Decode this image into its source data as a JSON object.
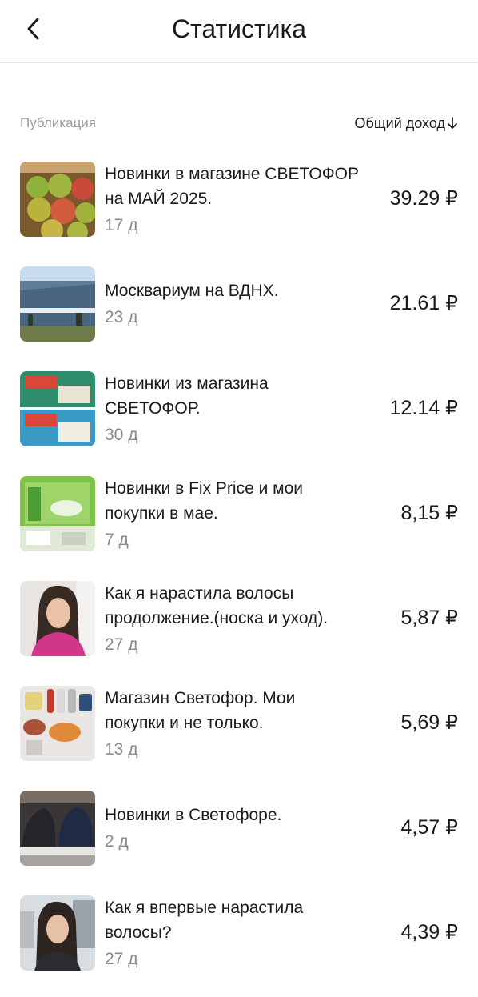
{
  "header": {
    "title": "Статистика",
    "back_icon": "chevron-left-icon"
  },
  "columns": {
    "left": "Публикация",
    "right": "Общий доход",
    "sort_icon": "arrow-down-icon"
  },
  "items": [
    {
      "title_line1": "Новинки в магазине СВЕТОФОР",
      "title_line2": "на МАЙ 2025.",
      "age": "17 д",
      "income": "39.29 ₽"
    },
    {
      "title_line1": "Москвариум на ВДНХ.",
      "title_line2": "",
      "age": "23 д",
      "income": "21.61 ₽"
    },
    {
      "title_line1": "Новинки из магазина",
      "title_line2": "СВЕТОФОР.",
      "age": "30 д",
      "income": "12.14 ₽"
    },
    {
      "title_line1": "Новинки в Fix Price и мои",
      "title_line2": "покупки в мае.",
      "age": "7 д",
      "income": "8,15 ₽"
    },
    {
      "title_line1": "Как я нарастила волосы",
      "title_line2": "продолжение.(носка и уход).",
      "age": "27 д",
      "income": "5,87 ₽"
    },
    {
      "title_line1": "Магазин Светофор. Мои",
      "title_line2": "покупки и не только.",
      "age": "13 д",
      "income": "5,69 ₽"
    },
    {
      "title_line1": "Новинки в Светофоре.",
      "title_line2": "",
      "age": "2 д",
      "income": "4,57 ₽"
    },
    {
      "title_line1": "Как я впервые нарастила",
      "title_line2": "волосы?",
      "age": "27 д",
      "income": "4,39 ₽"
    }
  ]
}
